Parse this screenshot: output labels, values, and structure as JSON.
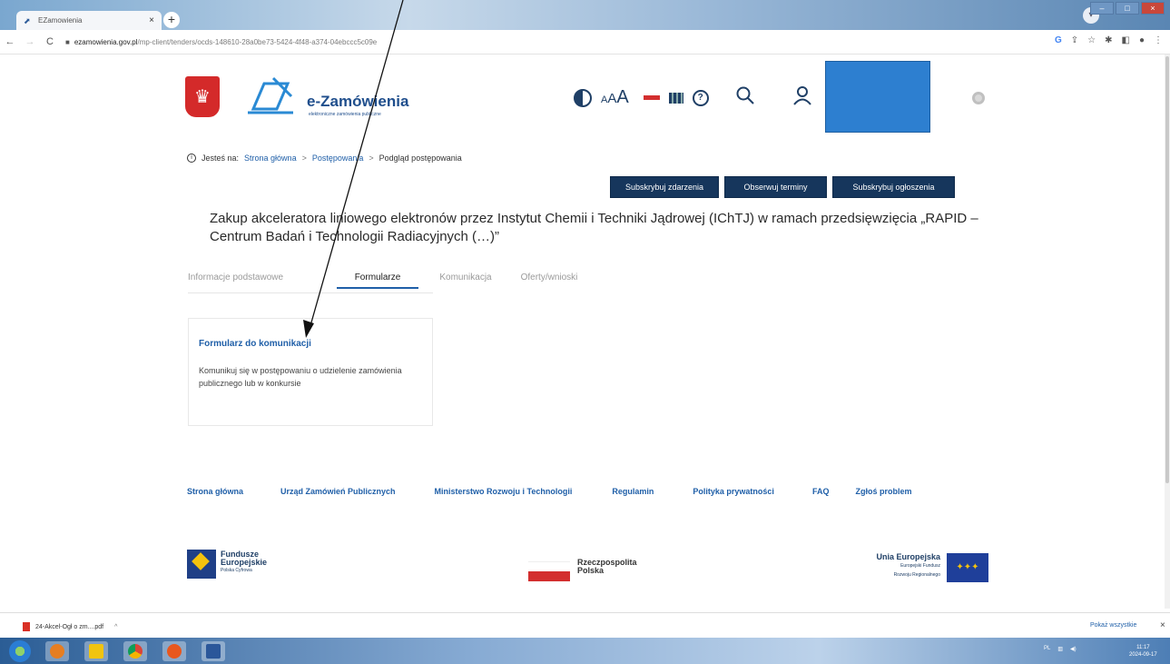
{
  "browser": {
    "tab_title": "EZamowienia",
    "tab_close": "×",
    "new_tab": "+",
    "url_host": "ezamowienia.gov.pl",
    "url_path": "/mp-client/tenders/ocds-148610-28a0be73-5424-4f48-a374-04ebccc5c09e"
  },
  "header": {
    "logo_title": "e-Zamówienia",
    "logo_subtitle": "elektroniczne zamówienia publiczne",
    "font_small": "A",
    "font_medium": "A",
    "font_large": "A",
    "help_icon": "?"
  },
  "breadcrumb": {
    "prefix": "Jesteś na:",
    "items": [
      "Strona główna",
      "Postępowania",
      "Podgląd postępowania"
    ],
    "separator": ">"
  },
  "actions": [
    "Subskrybuj zdarzenia",
    "Obserwuj terminy",
    "Subskrybuj ogłoszenia"
  ],
  "title": "Zakup akceleratora liniowego elektronów przez Instytut Chemii i Techniki Jądrowej (IChTJ) w ramach przedsięwzięcia „RAPID – Centrum Badań i Technologii Radiacyjnych (…)”",
  "tabs": [
    {
      "label": "Informacje podstawowe",
      "active": false
    },
    {
      "label": "Formularze",
      "active": true
    },
    {
      "label": "Komunikacja",
      "active": false
    },
    {
      "label": "Oferty/wnioski",
      "active": false
    }
  ],
  "card": {
    "title": "Formularz do komunikacji",
    "description": "Komunikuj się w postępowaniu o udzielenie zamówienia publicznego lub w konkursie"
  },
  "footer": {
    "links": [
      "Strona główna",
      "Urząd Zamówień Publicznych",
      "Ministerstwo Rozwoju i Technologii",
      "Regulamin",
      "Polityka prywatności",
      "FAQ",
      "Zgłoś problem"
    ],
    "logos": {
      "fe_line1": "Fundusze",
      "fe_line2": "Europejskie",
      "fe_line3": "Polska Cyfrowa",
      "rp_line1": "Rzeczpospolita",
      "rp_line2": "Polska",
      "ue_line1": "Unia Europejska",
      "ue_line2": "Europejski Fundusz",
      "ue_line3": "Rozwoju Regionalnego"
    }
  },
  "download_bar": {
    "file_name": "24-Akcel-Ogł o zm....pdf",
    "show_all": "Pokaż wszystkie",
    "close": "×"
  },
  "taskbar": {
    "time": "11:17",
    "date": "2024-09-17"
  },
  "colors": {
    "accent_blue": "#1f5fa8",
    "button_dark": "#16365c",
    "redaction": "#2d7fd0"
  }
}
